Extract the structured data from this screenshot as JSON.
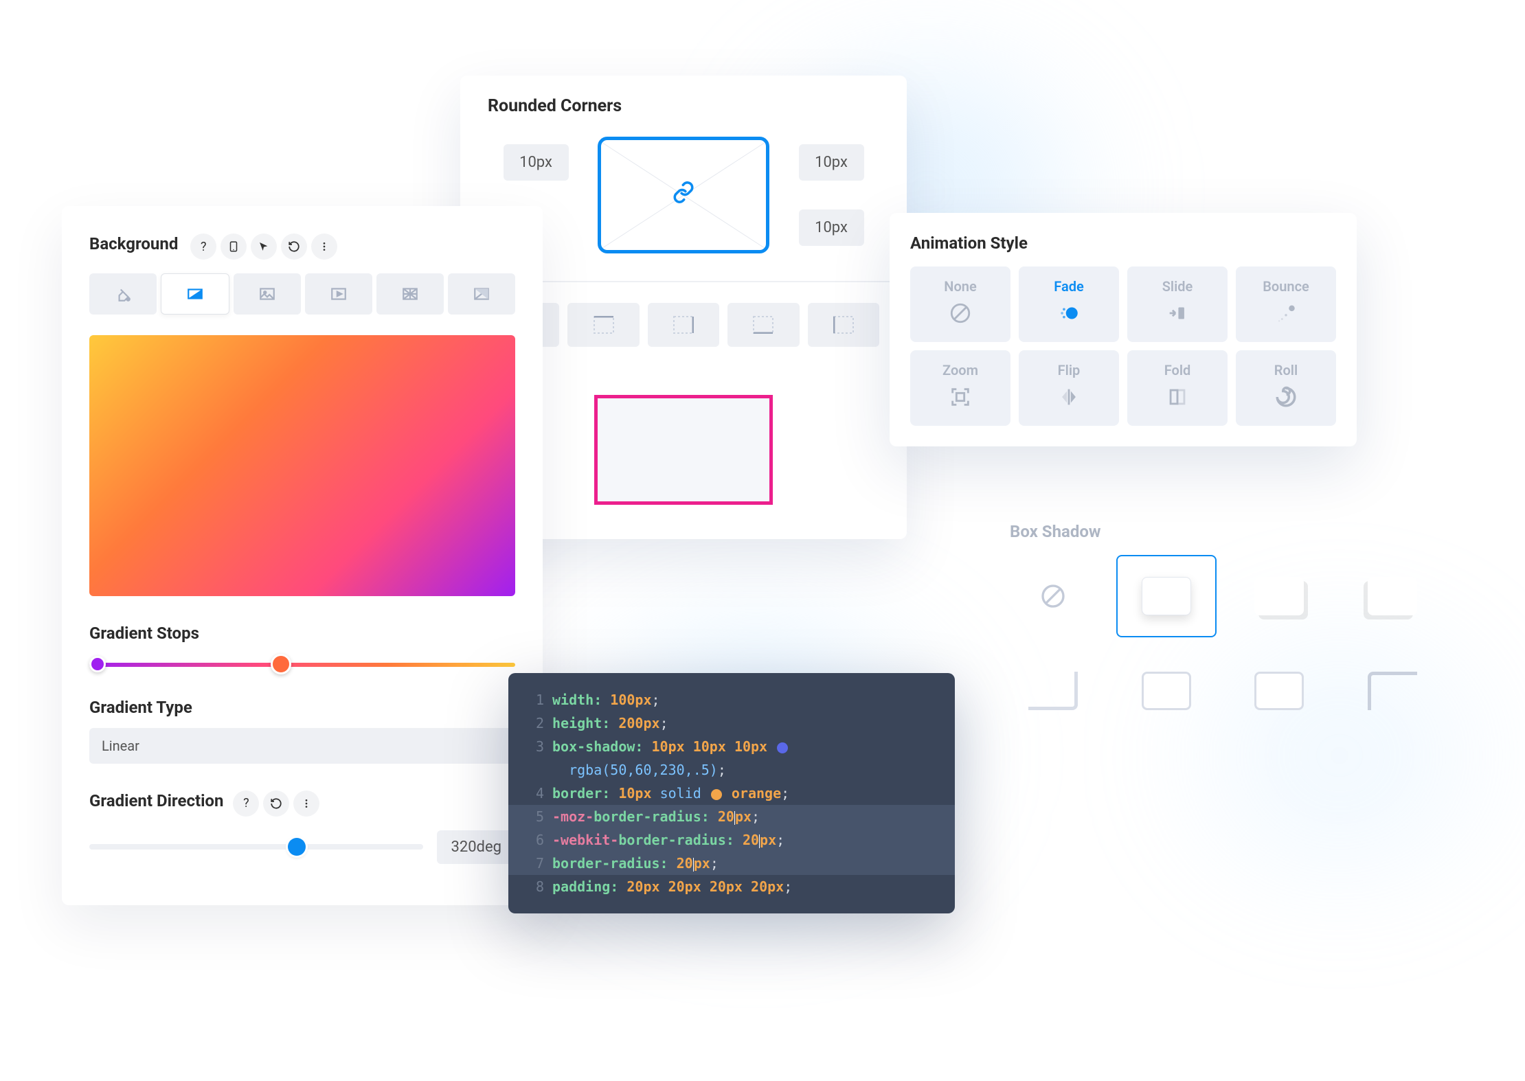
{
  "background_panel": {
    "title": "Background",
    "tabs": [
      "fill",
      "gradient",
      "image",
      "video",
      "pattern",
      "mask"
    ],
    "active_tab_index": 1,
    "stops": [
      {
        "pos": 0.02,
        "color": "#a020f0"
      },
      {
        "pos": 0.45,
        "color": "#ff6a3c"
      }
    ],
    "gradient_stops_label": "Gradient Stops",
    "gradient_type_label": "Gradient Type",
    "gradient_type_value": "Linear",
    "gradient_direction_label": "Gradient Direction",
    "direction_value": "320deg",
    "direction_slider_pos": 0.62
  },
  "corners_panel": {
    "title": "Rounded Corners",
    "tl": "10px",
    "tr": "10px",
    "br": "10px",
    "bl_hidden": true
  },
  "animation_panel": {
    "title": "Animation Style",
    "items": [
      "None",
      "Fade",
      "Slide",
      "Bounce",
      "Zoom",
      "Flip",
      "Fold",
      "Roll"
    ],
    "active_index": 1
  },
  "shadow_panel": {
    "title": "Box Shadow"
  },
  "code": {
    "swatch_blue": "#5a68e8",
    "swatch_orange": "#f2a54a",
    "lines": [
      {
        "n": 1,
        "prop": "width",
        "val": "100px"
      },
      {
        "n": 2,
        "prop": "height",
        "val": "200px"
      },
      {
        "n": 3,
        "prop": "box-shadow",
        "nums": [
          "10px",
          "10px",
          "10px"
        ],
        "rgba": "rgba(50,60,230,.5)"
      },
      {
        "n": 4,
        "prop": "border",
        "num": "10px",
        "kw2": "solid",
        "color": "orange"
      },
      {
        "n": 5,
        "prefix": "-moz-",
        "prop": "border-radius",
        "val": "20px",
        "hl": true
      },
      {
        "n": 6,
        "prefix": "-webkit-",
        "prop": "border-radius",
        "val": "20px",
        "hl": true
      },
      {
        "n": 7,
        "prop": "border-radius",
        "val": "20px",
        "hl": true
      },
      {
        "n": 8,
        "prop": "padding",
        "nums": [
          "20px",
          "20px",
          "20px",
          "20px"
        ]
      }
    ]
  }
}
